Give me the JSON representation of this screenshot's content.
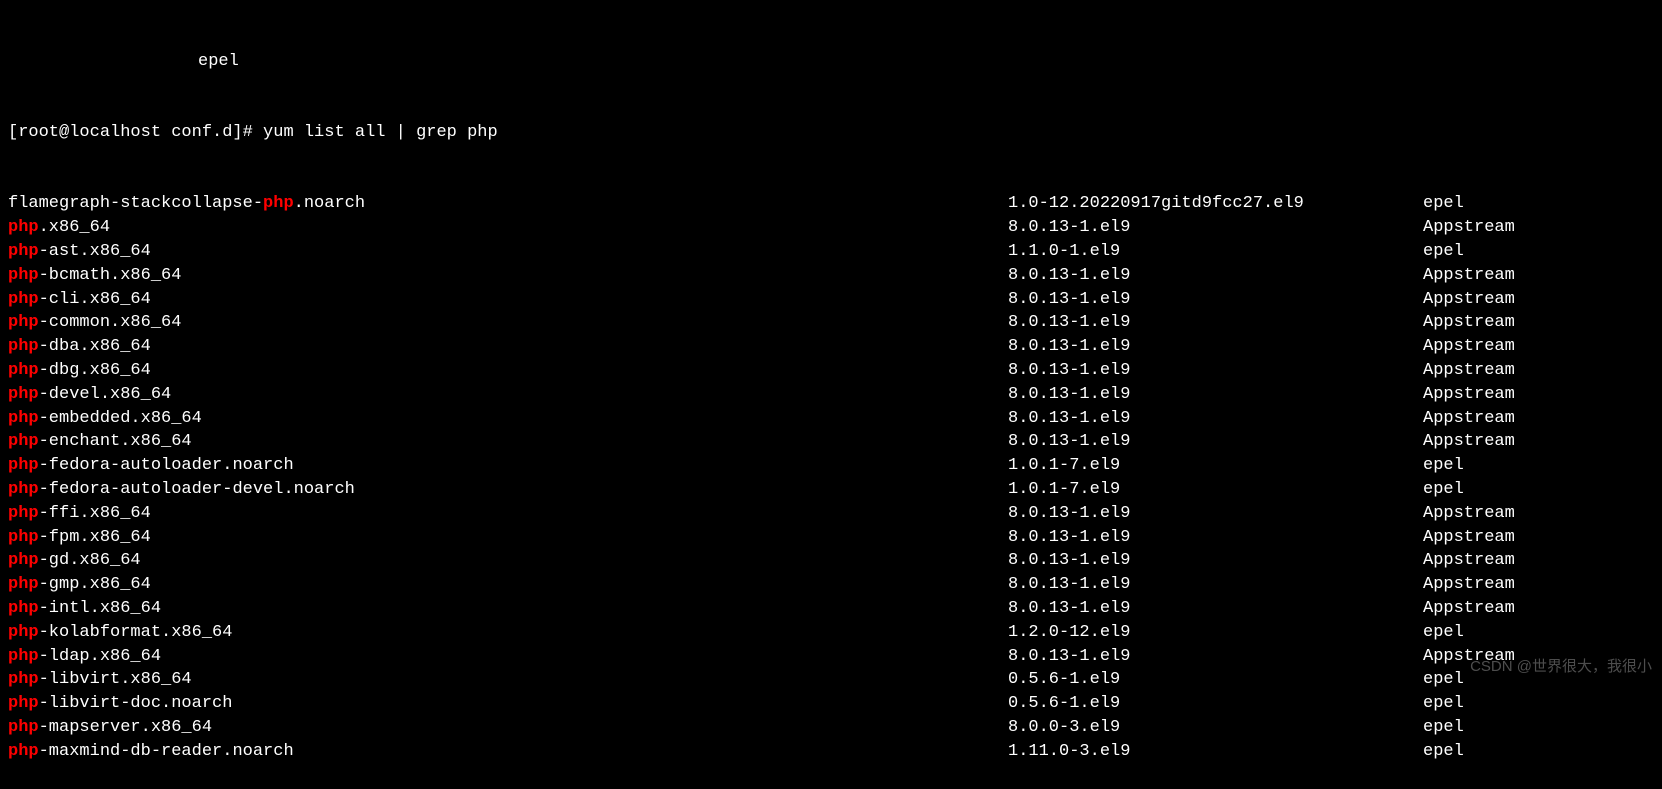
{
  "header_indent_repo": "epel",
  "prompt": "[root@localhost conf.d]# ",
  "command": "yum list all | grep php",
  "packages": [
    {
      "prefix": "flamegraph-stackcollapse-",
      "hl": "php",
      "suffix": ".noarch",
      "version": "1.0-12.20220917gitd9fcc27.el9",
      "repo": "epel"
    },
    {
      "prefix": "",
      "hl": "php",
      "suffix": ".x86_64",
      "version": "8.0.13-1.el9",
      "repo": "Appstream"
    },
    {
      "prefix": "",
      "hl": "php",
      "suffix": "-ast.x86_64",
      "version": "1.1.0-1.el9",
      "repo": "epel"
    },
    {
      "prefix": "",
      "hl": "php",
      "suffix": "-bcmath.x86_64",
      "version": "8.0.13-1.el9",
      "repo": "Appstream"
    },
    {
      "prefix": "",
      "hl": "php",
      "suffix": "-cli.x86_64",
      "version": "8.0.13-1.el9",
      "repo": "Appstream"
    },
    {
      "prefix": "",
      "hl": "php",
      "suffix": "-common.x86_64",
      "version": "8.0.13-1.el9",
      "repo": "Appstream"
    },
    {
      "prefix": "",
      "hl": "php",
      "suffix": "-dba.x86_64",
      "version": "8.0.13-1.el9",
      "repo": "Appstream"
    },
    {
      "prefix": "",
      "hl": "php",
      "suffix": "-dbg.x86_64",
      "version": "8.0.13-1.el9",
      "repo": "Appstream"
    },
    {
      "prefix": "",
      "hl": "php",
      "suffix": "-devel.x86_64",
      "version": "8.0.13-1.el9",
      "repo": "Appstream"
    },
    {
      "prefix": "",
      "hl": "php",
      "suffix": "-embedded.x86_64",
      "version": "8.0.13-1.el9",
      "repo": "Appstream"
    },
    {
      "prefix": "",
      "hl": "php",
      "suffix": "-enchant.x86_64",
      "version": "8.0.13-1.el9",
      "repo": "Appstream"
    },
    {
      "prefix": "",
      "hl": "php",
      "suffix": "-fedora-autoloader.noarch",
      "version": "1.0.1-7.el9",
      "repo": "epel"
    },
    {
      "prefix": "",
      "hl": "php",
      "suffix": "-fedora-autoloader-devel.noarch",
      "version": "1.0.1-7.el9",
      "repo": "epel"
    },
    {
      "prefix": "",
      "hl": "php",
      "suffix": "-ffi.x86_64",
      "version": "8.0.13-1.el9",
      "repo": "Appstream"
    },
    {
      "prefix": "",
      "hl": "php",
      "suffix": "-fpm.x86_64",
      "version": "8.0.13-1.el9",
      "repo": "Appstream"
    },
    {
      "prefix": "",
      "hl": "php",
      "suffix": "-gd.x86_64",
      "version": "8.0.13-1.el9",
      "repo": "Appstream"
    },
    {
      "prefix": "",
      "hl": "php",
      "suffix": "-gmp.x86_64",
      "version": "8.0.13-1.el9",
      "repo": "Appstream"
    },
    {
      "prefix": "",
      "hl": "php",
      "suffix": "-intl.x86_64",
      "version": "8.0.13-1.el9",
      "repo": "Appstream"
    },
    {
      "prefix": "",
      "hl": "php",
      "suffix": "-kolabformat.x86_64",
      "version": "1.2.0-12.el9",
      "repo": "epel"
    },
    {
      "prefix": "",
      "hl": "php",
      "suffix": "-ldap.x86_64",
      "version": "8.0.13-1.el9",
      "repo": "Appstream"
    },
    {
      "prefix": "",
      "hl": "php",
      "suffix": "-libvirt.x86_64",
      "version": "0.5.6-1.el9",
      "repo": "epel"
    },
    {
      "prefix": "",
      "hl": "php",
      "suffix": "-libvirt-doc.noarch",
      "version": "0.5.6-1.el9",
      "repo": "epel"
    },
    {
      "prefix": "",
      "hl": "php",
      "suffix": "-mapserver.x86_64",
      "version": "8.0.0-3.el9",
      "repo": "epel"
    },
    {
      "prefix": "",
      "hl": "php",
      "suffix": "-maxmind-db-reader.noarch",
      "version": "1.11.0-3.el9",
      "repo": "epel"
    }
  ],
  "watermark": "CSDN @世界很大，我很小"
}
